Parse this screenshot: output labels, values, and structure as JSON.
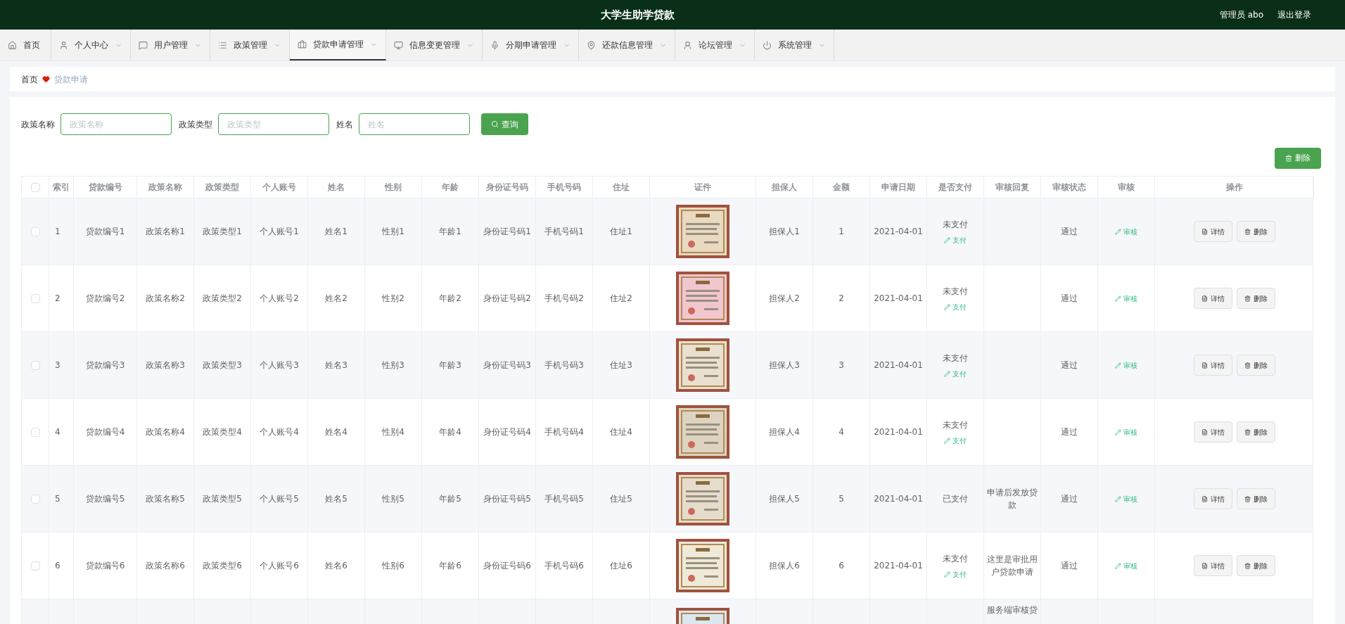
{
  "header": {
    "title": "大学生助学贷款",
    "user": "管理员 abo",
    "logout": "退出登录"
  },
  "nav": [
    {
      "label": "首页",
      "selected": false,
      "dropdown": false
    },
    {
      "label": "个人中心",
      "selected": false,
      "dropdown": true
    },
    {
      "label": "用户管理",
      "selected": false,
      "dropdown": true
    },
    {
      "label": "政策管理",
      "selected": false,
      "dropdown": true
    },
    {
      "label": "贷款申请管理",
      "selected": true,
      "dropdown": true
    },
    {
      "label": "信息变更管理",
      "selected": false,
      "dropdown": true
    },
    {
      "label": "分期申请管理",
      "selected": false,
      "dropdown": true
    },
    {
      "label": "还款信息管理",
      "selected": false,
      "dropdown": true
    },
    {
      "label": "论坛管理",
      "selected": false,
      "dropdown": true
    },
    {
      "label": "系统管理",
      "selected": false,
      "dropdown": true
    }
  ],
  "breadcrumb": {
    "home": "首页",
    "current": "贷款申请"
  },
  "search": {
    "fields": [
      {
        "label": "政策名称",
        "placeholder": "政策名称"
      },
      {
        "label": "政策类型",
        "placeholder": "政策类型"
      },
      {
        "label": "姓名",
        "placeholder": "姓名"
      }
    ],
    "button": "查询"
  },
  "delete_button": "删除",
  "table": {
    "select_all_checked": false,
    "columns": [
      "索引",
      "贷款编号",
      "政策名称",
      "政策类型",
      "个人账号",
      "姓名",
      "性别",
      "年龄",
      "身份证号码",
      "手机号码",
      "住址",
      "证件",
      "担保人",
      "金额",
      "申请日期",
      "是否支付",
      "审核回复",
      "审核状态",
      "审核",
      "操作"
    ],
    "rows": [
      {
        "checked": false,
        "cells": [
          "1",
          "贷款编号1",
          "政策名称1",
          "政策类型1",
          "个人账号1",
          "姓名1",
          "性别1",
          "年龄1",
          "身份证号码1",
          "手机号码1",
          "住址1"
        ],
        "certificate": {
          "kind": "picture"
        },
        "cells2": [
          "担保人1",
          "1",
          "2021-04-01"
        ],
        "pay_status": "未支付",
        "pay_action": "支付",
        "audit_status": "通过",
        "audit_action": "审核",
        "actions": [
          "详情",
          "删除"
        ]
      },
      {
        "checked": false,
        "cells": [
          "2",
          "贷款编号2",
          "政策名称2",
          "政策类型2",
          "个人账号2",
          "姓名2",
          "性别2",
          "年龄2",
          "身份证号码2",
          "手机号码2",
          "住址2"
        ],
        "certificate": {
          "kind": "picture"
        },
        "cells2": [
          "担保人2",
          "2",
          "2021-04-01"
        ],
        "pay_status": "未支付",
        "pay_action": "支付",
        "audit_status": "通过",
        "audit_action": "审核",
        "actions": [
          "详情",
          "删除"
        ]
      },
      {
        "checked": false,
        "cells": [
          "3",
          "贷款编号3",
          "政策名称3",
          "政策类型3",
          "个人账号3",
          "姓名3",
          "性别3",
          "年龄3",
          "身份证号码3",
          "手机号码3",
          "住址3"
        ],
        "certificate": {
          "kind": "picture"
        },
        "cells2": [
          "担保人3",
          "3",
          "2021-04-01"
        ],
        "pay_status": "未支付",
        "pay_action": "支付",
        "audit_status": "通过",
        "audit_action": "审核",
        "actions": [
          "详情",
          "删除"
        ]
      },
      {
        "checked": false,
        "cells": [
          "4",
          "贷款编号4",
          "政策名称4",
          "政策类型4",
          "个人账号4",
          "姓名4",
          "性别4",
          "年龄4",
          "身份证号码4",
          "手机号码4",
          "住址4"
        ],
        "certificate": {
          "kind": "picture"
        },
        "cells2": [
          "担保人4",
          "4",
          "2021-04-01"
        ],
        "pay_status": "未支付",
        "pay_action": "支付",
        "audit_status": "通过",
        "audit_action": "审核",
        "actions": [
          "详情",
          "删除"
        ]
      },
      {
        "checked": false,
        "cells": [
          "5",
          "贷款编号5",
          "政策名称5",
          "政策类型5",
          "个人账号5",
          "姓名5",
          "性别5",
          "年龄5",
          "身份证号码5",
          "手机号码5",
          "住址5"
        ],
        "certificate": {
          "kind": "picture"
        },
        "cells2": [
          "担保人5",
          "5",
          "2021-04-01"
        ],
        "pay_status": "已支付",
        "reply": "申请后发放贷款",
        "audit_status": "通过",
        "audit_action": "审核",
        "actions": [
          "详情",
          "删除"
        ]
      },
      {
        "checked": false,
        "cells": [
          "6",
          "贷款编号6",
          "政策名称6",
          "政策类型6",
          "个人账号6",
          "姓名6",
          "性别6",
          "年龄6",
          "身份证号码6",
          "手机号码6",
          "住址6"
        ],
        "certificate": {
          "kind": "picture"
        },
        "cells2": [
          "担保人6",
          "6",
          "2021-04-01"
        ],
        "pay_status": "未支付",
        "pay_action": "支付",
        "reply": "这里是审批用户贷款申请",
        "audit_status": "通过",
        "audit_action": "审核",
        "actions": [
          "详情",
          "删除"
        ]
      },
      {
        "certificate": {
          "kind": "picture"
        },
        "reply": "服务端审核贷"
      }
    ]
  }
}
